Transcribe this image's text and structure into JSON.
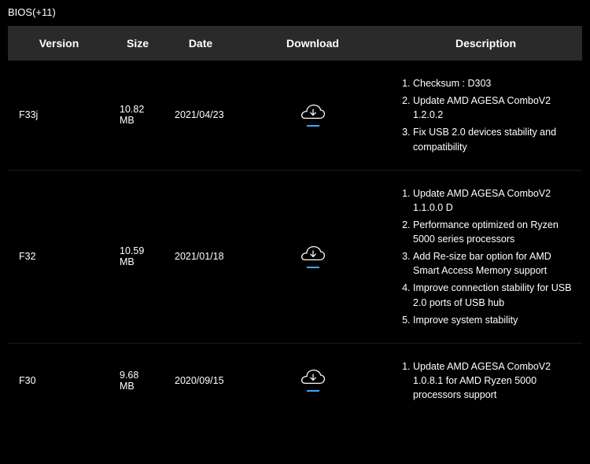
{
  "section": {
    "title": "BIOS(+11)"
  },
  "table": {
    "headers": {
      "version": "Version",
      "size": "Size",
      "date": "Date",
      "download": "Download",
      "description": "Description"
    },
    "rows": [
      {
        "version": "F33j",
        "size": "10.82 MB",
        "date": "2021/04/23",
        "description": [
          "Checksum : D303",
          "Update AMD AGESA ComboV2 1.2.0.2",
          "Fix USB 2.0 devices stability and compatibility"
        ]
      },
      {
        "version": "F32",
        "size": "10.59 MB",
        "date": "2021/01/18",
        "description": [
          "Update AMD AGESA ComboV2 1.1.0.0 D",
          "Performance optimized on Ryzen 5000 series processors",
          "Add Re-size bar option for AMD Smart Access Memory support",
          "Improve connection stability for USB 2.0 ports of USB hub",
          "Improve system stability"
        ]
      },
      {
        "version": "F30",
        "size": "9.68 MB",
        "date": "2020/09/15",
        "description": [
          "Update AMD AGESA ComboV2 1.0.8.1 for AMD Ryzen 5000 processors support"
        ]
      }
    ]
  }
}
